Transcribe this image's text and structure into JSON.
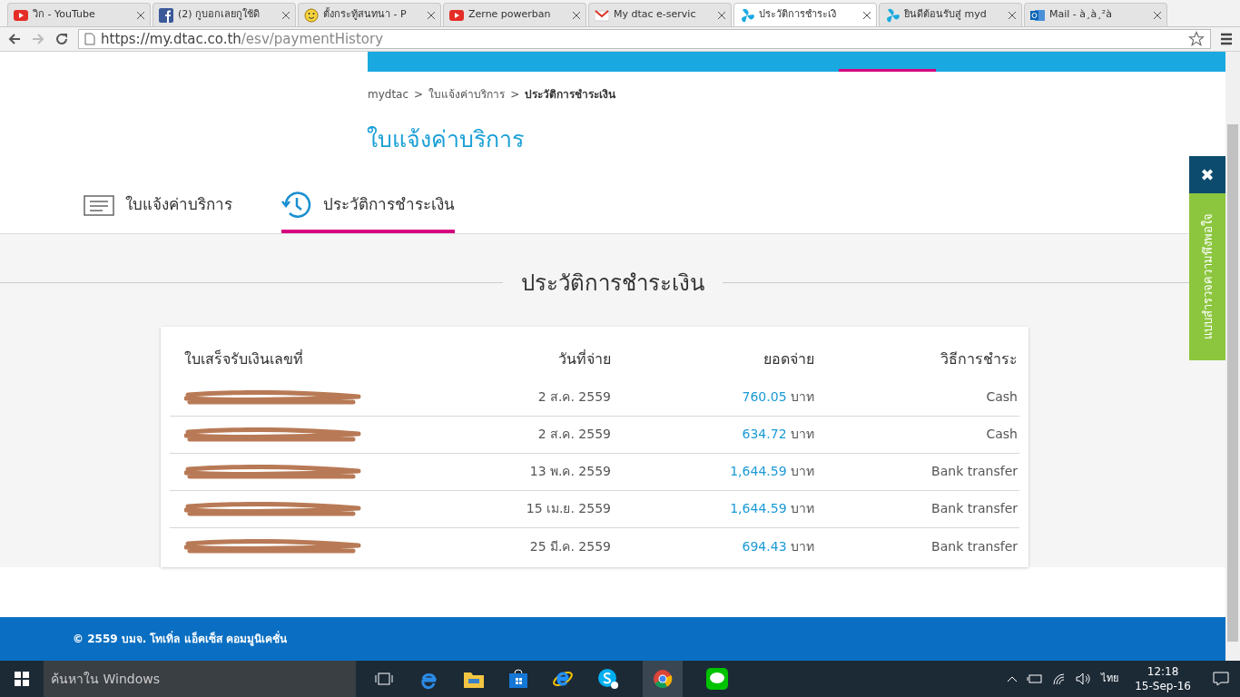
{
  "browser": {
    "tabs": [
      {
        "title": "วิก - YouTube",
        "selected": false
      },
      {
        "title": "(2) กูบอกเลยกูใช้ดิ",
        "selected": false
      },
      {
        "title": "ตั้งกระทู้สนทนา - P",
        "selected": false
      },
      {
        "title": "Zerne powerban",
        "selected": false
      },
      {
        "title": "My dtac e-servic",
        "selected": false
      },
      {
        "title": "ประวัติการชำระเงิ",
        "selected": true
      },
      {
        "title": "ยินดีต้อนรับสู่ myd",
        "selected": false
      },
      {
        "title": "Mail - à¸à¸²à",
        "selected": false
      }
    ],
    "url_host": "https://my.dtac.co.th",
    "url_path": "/esv/paymentHistory"
  },
  "breadcrumb": [
    {
      "kind": "link",
      "text": "mydtac"
    },
    {
      "kind": "separator",
      "text": ">"
    },
    {
      "kind": "link",
      "text": "ใบแจ้งค่าบริการ"
    },
    {
      "kind": "separator",
      "text": ">"
    },
    {
      "kind": "current",
      "text": "ประวัติการชำระเงิน"
    }
  ],
  "page_title": "ใบแจ้งค่าบริการ",
  "section_tabs": [
    {
      "label": "ใบแจ้งค่าบริการ",
      "kind": "bill",
      "selected": false
    },
    {
      "label": "ประวัติการชำระเงิน",
      "kind": "history",
      "selected": true
    }
  ],
  "heading": "ประวัติการชำระเงิน",
  "table": {
    "columns": [
      "ใบเสร็จรับเงินเลขที่",
      "วันที่จ่าย",
      "ยอดจ่าย",
      "วิธีการชำระ"
    ],
    "rows": [
      {
        "date": "2 ส.ค. 2559",
        "amount": "760.05",
        "currency": "บาท",
        "method": "Cash"
      },
      {
        "date": "2 ส.ค. 2559",
        "amount": "634.72",
        "currency": "บาท",
        "method": "Cash"
      },
      {
        "date": "13 พ.ค. 2559",
        "amount": "1,644.59",
        "currency": "บาท",
        "method": "Bank transfer"
      },
      {
        "date": "15 เม.ย. 2559",
        "amount": "1,644.59",
        "currency": "บาท",
        "method": "Bank transfer"
      },
      {
        "date": "25 มี.ค. 2559",
        "amount": "694.43",
        "currency": "บาท",
        "method": "Bank transfer"
      }
    ]
  },
  "feedback": {
    "close": "✖",
    "label": "แบบสำรวจความพึงพอใจ"
  },
  "footer": "© 2559 บมจ. โทเทิ่ล แอ็คเซ็ส คอมมูนิเคชั่น",
  "taskbar": {
    "search_placeholder": "ค้นหาใน Windows",
    "language": "ไทย",
    "time": "12:18",
    "date": "15-Sep-16"
  }
}
